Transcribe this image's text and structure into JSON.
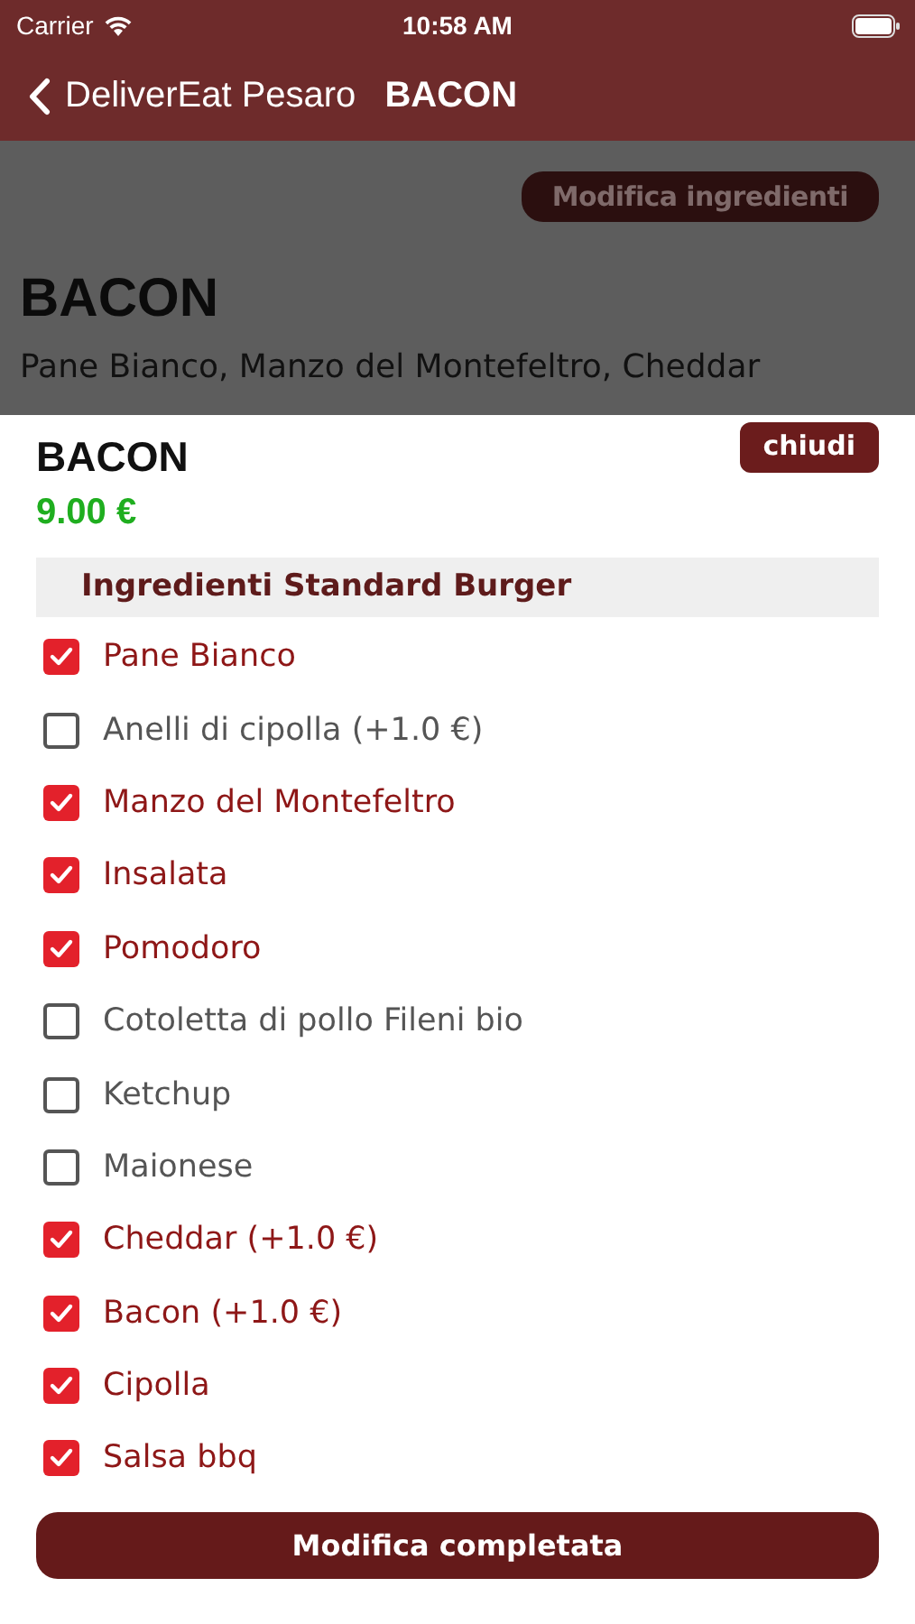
{
  "status_bar": {
    "carrier": "Carrier",
    "time": "10:58 AM"
  },
  "nav_bar": {
    "back_label": "DeliverEat Pesaro",
    "title": "BACON"
  },
  "background_page": {
    "edit_button": "Modifica ingredienti",
    "title": "BACON",
    "ingredients_text": "Pane Bianco, Manzo del Montefeltro, Cheddar"
  },
  "sheet": {
    "title": "BACON",
    "close_button": "chiudi",
    "price": "9.00 €",
    "section_header": "Ingredienti Standard Burger",
    "ingredients": [
      {
        "label": "Pane Bianco",
        "checked": true
      },
      {
        "label": "Anelli di cipolla (+1.0 €)",
        "checked": false
      },
      {
        "label": "Manzo del Montefeltro",
        "checked": true
      },
      {
        "label": "Insalata",
        "checked": true
      },
      {
        "label": "Pomodoro",
        "checked": true
      },
      {
        "label": "Cotoletta di pollo Fileni bio",
        "checked": false
      },
      {
        "label": "Ketchup",
        "checked": false
      },
      {
        "label": "Maionese",
        "checked": false
      },
      {
        "label": "Cheddar (+1.0 €)",
        "checked": true
      },
      {
        "label": "Bacon (+1.0 €)",
        "checked": true
      },
      {
        "label": "Cipolla",
        "checked": true
      },
      {
        "label": "Salsa bbq",
        "checked": true
      }
    ],
    "done_button": "Modifica completata"
  }
}
